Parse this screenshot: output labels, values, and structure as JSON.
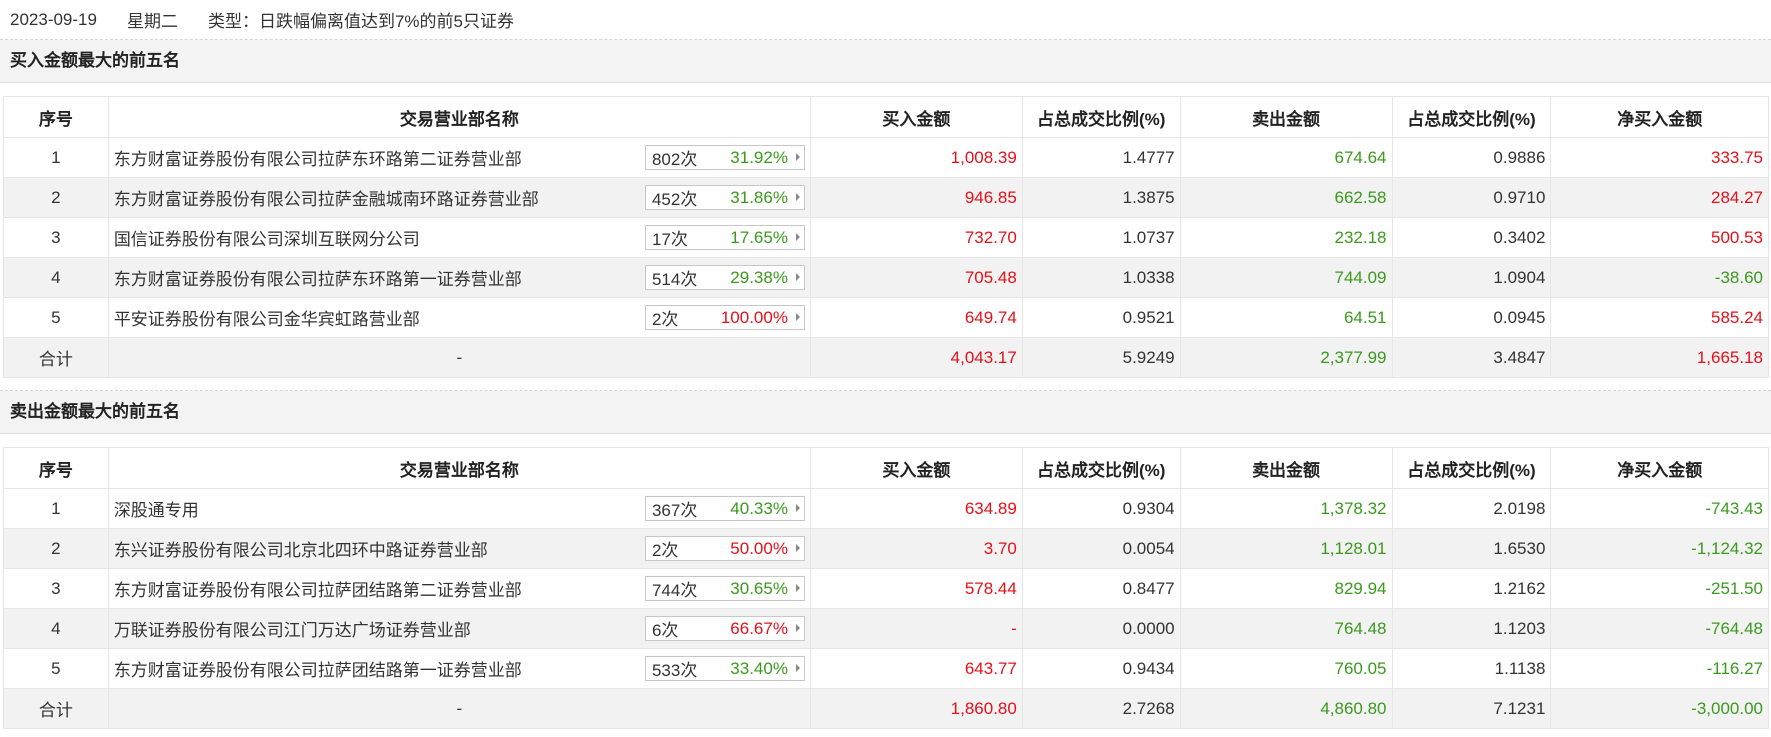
{
  "header": {
    "date": "2023-09-19",
    "weekday": "星期二",
    "type": "类型：日跌幅偏离值达到7%的前5只证券"
  },
  "columns": [
    "序号",
    "交易营业部名称",
    "买入金额",
    "占总成交比例(%)",
    "卖出金额",
    "占总成交比例(%)",
    "净买入金额"
  ],
  "colors": {
    "up": "#e5111a",
    "down": "#3b9a1e"
  },
  "buy_section": {
    "title": "买入金额最大的前五名",
    "rows": [
      {
        "idx": "1",
        "name": "东方财富证券股份有限公司拉萨东环路第二证券营业部",
        "count": "802次",
        "pct": "31.92%",
        "pct_color": "green",
        "buy": "1,008.39",
        "buy_ratio": "1.4777",
        "sell": "674.64",
        "sell_ratio": "0.9886",
        "net": "333.75",
        "net_color": "red"
      },
      {
        "idx": "2",
        "name": "东方财富证券股份有限公司拉萨金融城南环路证券营业部",
        "count": "452次",
        "pct": "31.86%",
        "pct_color": "green",
        "buy": "946.85",
        "buy_ratio": "1.3875",
        "sell": "662.58",
        "sell_ratio": "0.9710",
        "net": "284.27",
        "net_color": "red"
      },
      {
        "idx": "3",
        "name": "国信证券股份有限公司深圳互联网分公司",
        "count": "17次",
        "pct": "17.65%",
        "pct_color": "green",
        "buy": "732.70",
        "buy_ratio": "1.0737",
        "sell": "232.18",
        "sell_ratio": "0.3402",
        "net": "500.53",
        "net_color": "red"
      },
      {
        "idx": "4",
        "name": "东方财富证券股份有限公司拉萨东环路第一证券营业部",
        "count": "514次",
        "pct": "29.38%",
        "pct_color": "green",
        "buy": "705.48",
        "buy_ratio": "1.0338",
        "sell": "744.09",
        "sell_ratio": "1.0904",
        "net": "-38.60",
        "net_color": "green"
      },
      {
        "idx": "5",
        "name": "平安证券股份有限公司金华宾虹路营业部",
        "count": "2次",
        "pct": "100.00%",
        "pct_color": "red",
        "buy": "649.74",
        "buy_ratio": "0.9521",
        "sell": "64.51",
        "sell_ratio": "0.0945",
        "net": "585.24",
        "net_color": "red"
      }
    ],
    "total": {
      "label": "合计",
      "name": "-",
      "buy": "4,043.17",
      "buy_ratio": "5.9249",
      "sell": "2,377.99",
      "sell_ratio": "3.4847",
      "net": "1,665.18",
      "net_color": "red"
    }
  },
  "sell_section": {
    "title": "卖出金额最大的前五名",
    "rows": [
      {
        "idx": "1",
        "name": "深股通专用",
        "count": "367次",
        "pct": "40.33%",
        "pct_color": "green",
        "buy": "634.89",
        "buy_ratio": "0.9304",
        "sell": "1,378.32",
        "sell_ratio": "2.0198",
        "net": "-743.43",
        "net_color": "green"
      },
      {
        "idx": "2",
        "name": "东兴证券股份有限公司北京北四环中路证券营业部",
        "count": "2次",
        "pct": "50.00%",
        "pct_color": "red",
        "buy": "3.70",
        "buy_ratio": "0.0054",
        "sell": "1,128.01",
        "sell_ratio": "1.6530",
        "net": "-1,124.32",
        "net_color": "green"
      },
      {
        "idx": "3",
        "name": "东方财富证券股份有限公司拉萨团结路第二证券营业部",
        "count": "744次",
        "pct": "30.65%",
        "pct_color": "green",
        "buy": "578.44",
        "buy_ratio": "0.8477",
        "sell": "829.94",
        "sell_ratio": "1.2162",
        "net": "-251.50",
        "net_color": "green"
      },
      {
        "idx": "4",
        "name": "万联证券股份有限公司江门万达广场证券营业部",
        "count": "6次",
        "pct": "66.67%",
        "pct_color": "red",
        "buy": "-",
        "buy_ratio": "0.0000",
        "sell": "764.48",
        "sell_ratio": "1.1203",
        "net": "-764.48",
        "net_color": "green"
      },
      {
        "idx": "5",
        "name": "东方财富证券股份有限公司拉萨团结路第一证券营业部",
        "count": "533次",
        "pct": "33.40%",
        "pct_color": "green",
        "buy": "643.77",
        "buy_ratio": "0.9434",
        "sell": "760.05",
        "sell_ratio": "1.1138",
        "net": "-116.27",
        "net_color": "green"
      }
    ],
    "total": {
      "label": "合计",
      "name": "-",
      "buy": "1,860.80",
      "buy_ratio": "2.7268",
      "sell": "4,860.80",
      "sell_ratio": "7.1231",
      "net": "-3,000.00",
      "net_color": "green"
    }
  }
}
